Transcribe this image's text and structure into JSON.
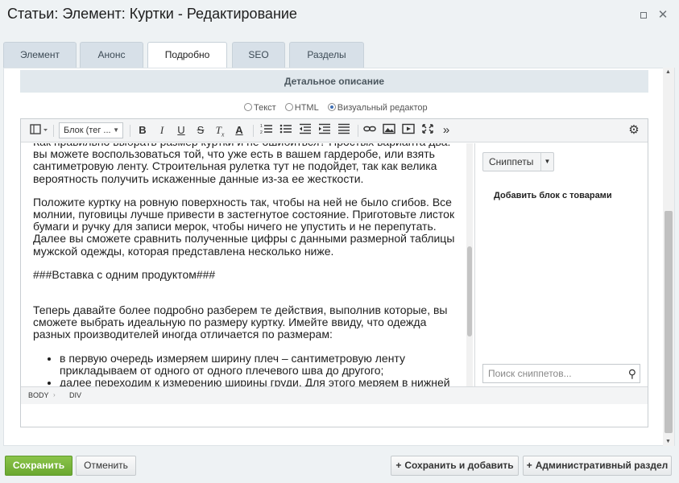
{
  "window": {
    "title": "Статьи: Элемент: Куртки - Редактирование"
  },
  "tabs": [
    {
      "label": "Элемент"
    },
    {
      "label": "Анонс"
    },
    {
      "label": "Подробно"
    },
    {
      "label": "SEO"
    },
    {
      "label": "Разделы"
    }
  ],
  "active_tab": "Подробно",
  "section": {
    "title": "Детальное описание"
  },
  "modes": {
    "text": "Текст",
    "html": "HTML",
    "visual": "Визуальный редактор",
    "selected": "visual"
  },
  "toolbar": {
    "block_select": "Блок (тег ...",
    "icons": [
      "view-mode-icon",
      "bold-icon",
      "italic-icon",
      "underline-icon",
      "strikethrough-icon",
      "clear-format-icon",
      "font-color-icon",
      "ordered-list-icon",
      "unordered-list-icon",
      "outdent-icon",
      "indent-icon",
      "align-icon",
      "link-icon",
      "image-icon",
      "video-icon",
      "fullscreen-icon",
      "more-icon",
      "settings-icon"
    ]
  },
  "content": {
    "paragraphs": [
      "Как правильно выбрать размер куртки и не ошибиться? Простых варианта два: вы можете воспользоваться той, что уже есть в вашем гардеробе, или взять сантиметровую ленту. Строительная рулетка тут не подойдет, так как велика вероятность получить искаженные данные из-за ее жесткости.",
      "Положите куртку на ровную поверхность так, чтобы на ней не было сгибов. Все молнии, пуговицы лучше привести в застегнутое состояние. Приготовьте листок бумаги и ручку для записи мерок, чтобы ничего не упустить и не перепутать. Далее вы сможете сравнить полученные цифры с данными размерной таблицы мужской одежды, которая представлена несколько ниже.",
      "###Вставка с одним продуктом###",
      "Теперь давайте более подробно разберем те действия, выполнив которые, вы сможете выбрать идеальную по размеру куртку. Имейте ввиду, что одежда разных производителей иногда отличается по размерам:"
    ],
    "list": [
      "в первую очередь измеряем ширину плеч – сантиметровую ленту прикладываем от одного от одного плечевого шва до другого;",
      "далее переходим к измерению ширины груди. Для этого меряем в нижней части проймы, там, где рукав соединен с боковым швом. Ленту проводим от одного шва до другого;"
    ]
  },
  "snippets": {
    "button": "Сниппеты",
    "add_block": "Добавить блок с товарами",
    "search_placeholder": "Поиск сниппетов..."
  },
  "pathbar": {
    "items": [
      "BODY",
      "DIV"
    ]
  },
  "footer": {
    "save": "Сохранить",
    "cancel": "Отменить",
    "save_add": "Сохранить и добавить",
    "admin": "Административный раздел"
  }
}
